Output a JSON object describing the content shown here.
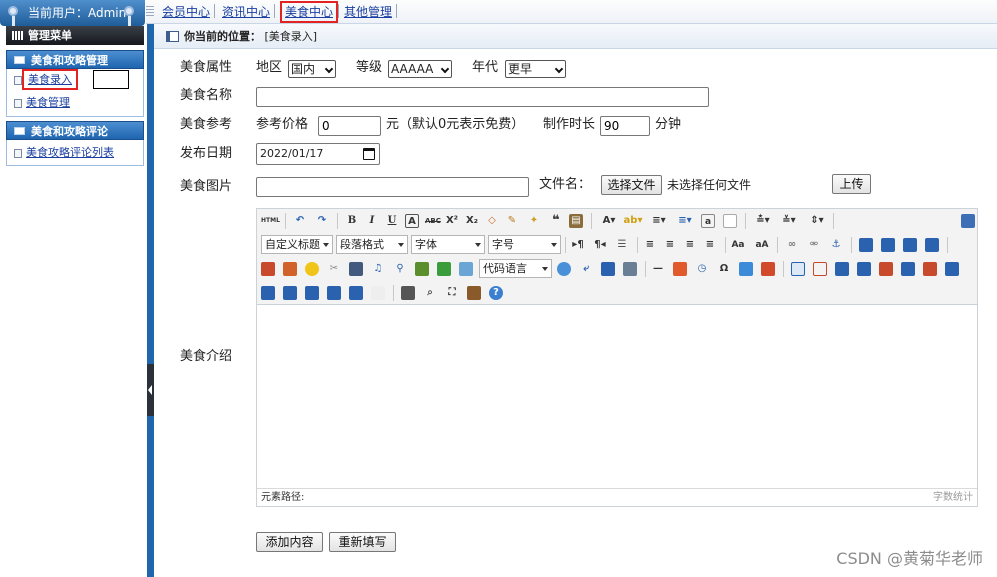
{
  "user": {
    "label": "当前用户：Admin"
  },
  "topnav": {
    "items": [
      "会员中心",
      "资讯中心",
      "美食中心",
      "其他管理"
    ],
    "active_index": 2
  },
  "sidebar": {
    "title": "管理菜单",
    "groups": [
      {
        "title": "美食和攻略管理",
        "items": [
          "美食录入",
          "美食管理"
        ],
        "active_index": 0
      },
      {
        "title": "美食和攻略评论",
        "items": [
          "美食攻略评论列表"
        ]
      }
    ]
  },
  "location": {
    "label": "你当前的位置：",
    "value": "[美食录入]"
  },
  "form": {
    "attr_label": "美食属性",
    "region_label": "地区",
    "region_value": "国内",
    "grade_label": "等级",
    "grade_value": "AAAAA",
    "era_label": "年代",
    "era_value": "更早",
    "name_label": "美食名称",
    "name_value": "",
    "ref_label": "美食参考",
    "price_label": "参考价格",
    "price_value": "0",
    "price_unit": "元（默认0元表示免费）",
    "duration_label": "制作时长",
    "duration_value": "90",
    "duration_unit": "分钟",
    "date_label": "发布日期",
    "date_value": "2022/01/17",
    "image_label": "美食图片",
    "image_path": "",
    "filename_label": "文件名：",
    "choose_file_button": "选择文件",
    "no_file_text": "未选择任何文件",
    "upload_button": "上传",
    "intro_label": "美食介绍",
    "submit_button": "添加内容",
    "reset_button": "重新填写"
  },
  "editor": {
    "combos": [
      "自定义标题",
      "段落格式",
      "字体",
      "字号",
      "代码语言"
    ],
    "status_left": "元素路径:",
    "status_right": "字数统计",
    "html_label": "HTML"
  },
  "watermark": "CSDN @黄菊华老师"
}
